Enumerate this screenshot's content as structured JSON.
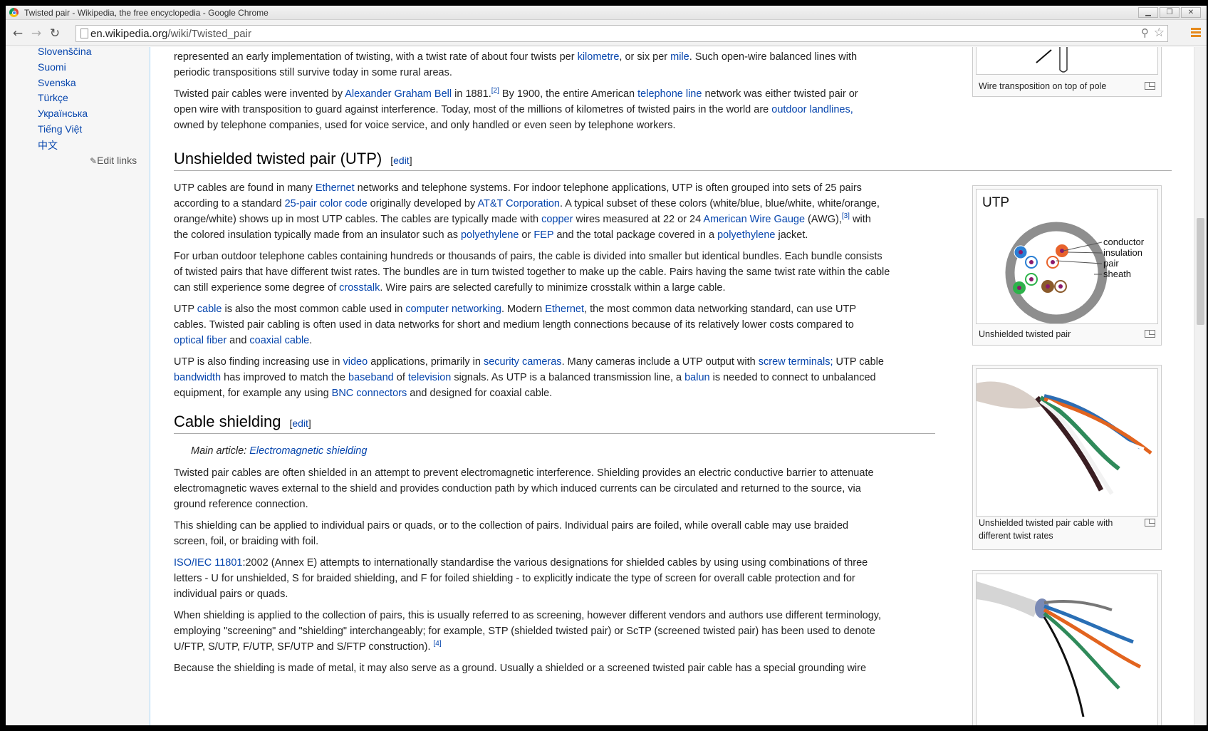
{
  "window": {
    "title": "Twisted pair - Wikipedia, the free encyclopedia - Google Chrome",
    "minimize": "▁",
    "restore": "❐",
    "close": "✕"
  },
  "toolbar": {
    "back": "←",
    "forward": "→",
    "reload": "↻",
    "url_host": "en.wikipedia.org",
    "url_path": "/wiki/Twisted_pair",
    "zoom": "⚲",
    "star": "☆"
  },
  "sidebar": {
    "languages": [
      "Slovenščina",
      "Suomi",
      "Svenska",
      "Türkçe",
      "Українська",
      "Tiếng Việt",
      "中文"
    ],
    "edit_links": "Edit links"
  },
  "article": {
    "p_history1_line1": {
      "t1": "represented an early implementation of twisting, with a twist rate of about four twists per ",
      "a1": "kilometre",
      "t2": ", or six per ",
      "a2": "mile",
      "t3": ". Such open-wire balanced lines with"
    },
    "p_history1_line2": "periodic transpositions still survive today in some rural areas.",
    "p_history2": {
      "t1": "Twisted pair cables were invented by ",
      "a1": "Alexander Graham Bell",
      "t2": " in 1881.",
      "ref1": "[2]",
      "t3": " By 1900, the entire American ",
      "a2": "telephone line",
      "t4": " network was either twisted pair or",
      "l2_t1": "open wire with transposition to guard against interference. Today, most of the millions of kilometres of twisted pairs in the world are ",
      "l2_a1": "outdoor landlines,",
      "l3": "owned by telephone companies, used for voice service, and only handled or even seen by telephone workers."
    },
    "utp_heading": "Unshielded twisted pair (UTP)",
    "edit_open": "[",
    "edit_label": "edit",
    "edit_close": "]",
    "utp_p1": {
      "t1": "UTP cables are found in many ",
      "a1": "Ethernet",
      "t2": " networks and telephone systems. For indoor telephone applications, UTP is often grouped into sets of 25 pairs",
      "l2_t1": "according to a standard ",
      "l2_a1": "25-pair color code",
      "l2_t2": " originally developed by ",
      "l2_a2": "AT&T Corporation",
      "l2_t3": ". A typical subset of these colors (white/blue, blue/white, white/orange,",
      "l3_t1": "orange/white) shows up in most UTP cables. The cables are typically made with ",
      "l3_a1": "copper",
      "l3_t2": " wires measured at 22 or 24 ",
      "l3_a2": "American Wire Gauge",
      "l3_t3": " (AWG),",
      "l3_ref": "[3]",
      "l3_t4": " with",
      "l4_t1": "the colored insulation typically made from an insulator such as ",
      "l4_a1": "polyethylene",
      "l4_t2": " or ",
      "l4_a2": "FEP",
      "l4_t3": " and the total package covered in a ",
      "l4_a3": "polyethylene",
      "l4_t4": " jacket."
    },
    "utp_p2": {
      "l1": "For urban outdoor telephone cables containing hundreds or thousands of pairs, the cable is divided into smaller but identical bundles. Each bundle consists",
      "l2": "of twisted pairs that have different twist rates. The bundles are in turn twisted together to make up the cable. Pairs having the same twist rate within the cable",
      "l3_t1": "can still experience some degree of ",
      "l3_a1": "crosstalk",
      "l3_t2": ". Wire pairs are selected carefully to minimize crosstalk within a large cable."
    },
    "utp_p3": {
      "t1": "UTP ",
      "a1": "cable",
      "t2": " is also the most common cable used in ",
      "a2": "computer networking",
      "t3": ". Modern ",
      "a3": "Ethernet",
      "t4": ", the most common data networking standard, can use UTP",
      "l2": "cables. Twisted pair cabling is often used in data networks for short and medium length connections because of its relatively lower costs compared to",
      "l3_a1": "optical fiber",
      "l3_t1": " and ",
      "l3_a2": "coaxial cable",
      "l3_t2": "."
    },
    "utp_p4": {
      "t1": "UTP is also finding increasing use in ",
      "a1": "video",
      "t2": " applications, primarily in ",
      "a2": "security cameras",
      "t3": ". Many cameras include a UTP output with ",
      "a3": "screw terminals;",
      "t4": " UTP cable",
      "l2_a1": "bandwidth",
      "l2_t1": " has improved to match the ",
      "l2_a2": "baseband",
      "l2_t2": " of ",
      "l2_a3": "television",
      "l2_t3": " signals. As UTP is a balanced transmission line, a ",
      "l2_a4": "balun",
      "l2_t4": " is needed to connect to unbalanced",
      "l3_t1": "equipment, for example any using ",
      "l3_a1": "BNC connectors",
      "l3_t2": " and designed for coaxial cable."
    },
    "shield_heading": "Cable shielding",
    "main_article_prefix": "Main article: ",
    "main_article_link": "Electromagnetic shielding",
    "shield_p1": {
      "l1": "Twisted pair cables are often shielded in an attempt to prevent electromagnetic interference. Shielding provides an electric conductive barrier to attenuate",
      "l2": "electromagnetic waves external to the shield and provides conduction path by which induced currents can be circulated and returned to the source, via",
      "l3": "ground reference connection."
    },
    "shield_p2": {
      "l1": "This shielding can be applied to individual pairs or quads, or to the collection of pairs. Individual pairs are foiled, while overall cable may use braided",
      "l2": "screen, foil, or braiding with foil."
    },
    "shield_p3": {
      "a1": "ISO/IEC 11801",
      "t1": ":2002 (Annex E) attempts to internationally standardise the various designations for shielded cables by using using combinations of three",
      "l2": "letters - U for unshielded, S for braided shielding, and F for foiled shielding - to explicitly indicate the type of screen for overall cable protection and for",
      "l3": "individual pairs or quads."
    },
    "shield_p4": {
      "l1": "When shielding is applied to the collection of pairs, this is usually referred to as screening, however different vendors and authors use different terminology,",
      "l2": "employing \"screening\" and \"shielding\" interchangeably; for example, STP (shielded twisted pair) or ScTP (screened twisted pair) has been used to denote",
      "l3_t1": "U/FTP, S/UTP, F/UTP, SF/UTP and S/FTP construction). ",
      "l3_ref": "[4]"
    },
    "shield_p5": "Because the shielding is made of metal, it may also serve as a ground. Usually a shielded or a screened twisted pair cable has a special grounding wire"
  },
  "figures": {
    "transposition_caption": "Wire transposition on top of pole",
    "utp_diagram_title": "UTP",
    "utp_labels": [
      "conductor",
      "insulation",
      "pair",
      "sheath"
    ],
    "utp_caption": "Unshielded twisted pair",
    "twist_caption_l1": "Unshielded twisted pair cable with",
    "twist_caption_l2": "different twist rates"
  }
}
